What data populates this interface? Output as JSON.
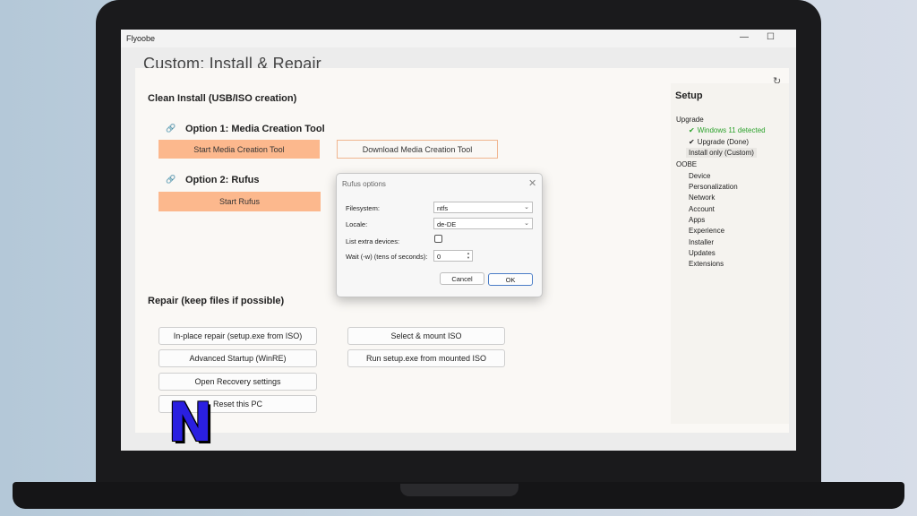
{
  "window": {
    "title": "Flyoobe",
    "minimize_glyph": "—",
    "maximize_glyph": "☐"
  },
  "background_heading": "Custom: Install & Repair",
  "clean_install": {
    "title": "Clean Install (USB/ISO creation)",
    "option1_title": "Option 1: Media Creation Tool",
    "start_mct_label": "Start Media Creation Tool",
    "download_mct_label": "Download Media Creation Tool",
    "option2_title": "Option 2: Rufus",
    "start_rufus_label": "Start Rufus"
  },
  "repair": {
    "title": "Repair (keep files if possible)",
    "inplace_label": "In-place repair (setup.exe from ISO)",
    "advanced_startup_label": "Advanced Startup (WinRE)",
    "recovery_label": "Open Recovery settings",
    "reset_label": "Reset this PC",
    "mount_iso_label": "Select & mount ISO",
    "run_setup_label": "Run setup.exe from mounted ISO"
  },
  "nav": {
    "title": "Setup",
    "upgrade": "Upgrade",
    "win11_detected": "Windows 11 detected",
    "upgrade_done": "Upgrade (Done)",
    "install_only": "Install only (Custom)",
    "oobe": "OOBE",
    "items": [
      "Device",
      "Personalization",
      "Network",
      "Account",
      "Apps",
      "Experience",
      "Installer",
      "Updates",
      "Extensions"
    ]
  },
  "rufus_dialog": {
    "title": "Rufus options",
    "filesystem_label": "Filesystem:",
    "filesystem_value": "ntfs",
    "locale_label": "Locale:",
    "locale_value": "de-DE",
    "list_devices_label": "List extra devices:",
    "wait_label": "Wait (-w) (tens of seconds):",
    "wait_value": "0",
    "cancel_label": "Cancel",
    "ok_label": "OK"
  },
  "icons": {
    "link": "link-icon",
    "refresh": "refresh-icon",
    "check": "check-icon",
    "close": "close-icon",
    "chevron": "chevron-down-icon"
  },
  "logo_letter": "N",
  "colors": {
    "accent_orange": "#fcb88d",
    "success_green": "#2aa12a",
    "logo_blue": "#2a1fe0"
  }
}
